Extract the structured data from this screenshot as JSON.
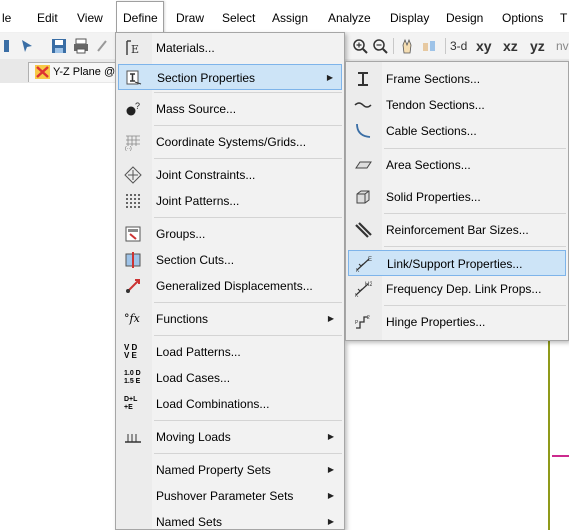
{
  "menubar": {
    "items": [
      {
        "label": "le"
      },
      {
        "label": "Edit"
      },
      {
        "label": "View"
      },
      {
        "label": "Define"
      },
      {
        "label": "Draw"
      },
      {
        "label": "Select"
      },
      {
        "label": "Assign"
      },
      {
        "label": "Analyze"
      },
      {
        "label": "Display"
      },
      {
        "label": "Design"
      },
      {
        "label": "Options"
      },
      {
        "label": "T"
      }
    ]
  },
  "toolbar": {
    "view_3d": "3-d",
    "view_xy": "xy",
    "view_xz": "xz",
    "view_yz": "yz",
    "view_nv": "nv"
  },
  "window_tab": {
    "title": "Y-Z Plane @"
  },
  "define_menu": {
    "items": [
      {
        "label": "Materials...",
        "icon": "materials-icon"
      },
      {
        "label": "Section Properties",
        "icon": "section-properties-icon",
        "submenu": true,
        "highlighted": true
      },
      {
        "label": "Mass Source...",
        "icon": "mass-source-icon"
      },
      {
        "label": "Coordinate Systems/Grids...",
        "icon": "grid-icon"
      },
      {
        "label": "Joint Constraints...",
        "icon": "joint-constraints-icon"
      },
      {
        "label": "Joint Patterns...",
        "icon": "joint-patterns-icon"
      },
      {
        "label": "Groups...",
        "icon": "groups-icon"
      },
      {
        "label": "Section Cuts...",
        "icon": "section-cuts-icon"
      },
      {
        "label": "Generalized Displacements...",
        "icon": "generalized-displacements-icon"
      },
      {
        "label": "Functions",
        "icon": "functions-icon",
        "submenu": true
      },
      {
        "label": "Load Patterns...",
        "icon": "load-patterns-icon"
      },
      {
        "label": "Load Cases...",
        "icon": "load-cases-icon"
      },
      {
        "label": "Load Combinations...",
        "icon": "load-combinations-icon"
      },
      {
        "label": "Moving Loads",
        "icon": "moving-loads-icon",
        "submenu": true
      },
      {
        "label": "Named Property Sets",
        "submenu": true
      },
      {
        "label": "Pushover Parameter Sets",
        "submenu": true
      },
      {
        "label": "Named Sets",
        "submenu": true
      }
    ],
    "icon_text": {
      "functions": "°fx",
      "load_patterns_top": "V D",
      "load_patterns_bottom": "V E",
      "load_cases_top": "1.0 D",
      "load_cases_bottom": "1.5 E",
      "load_combos_top": "D+L",
      "load_combos_bottom": "+E"
    }
  },
  "section_submenu": {
    "items": [
      {
        "label": "Frame Sections...",
        "icon": "frame-sections-icon"
      },
      {
        "label": "Tendon Sections...",
        "icon": "tendon-sections-icon"
      },
      {
        "label": "Cable Sections...",
        "icon": "cable-sections-icon"
      },
      {
        "label": "Area Sections...",
        "icon": "area-sections-icon"
      },
      {
        "label": "Solid Properties...",
        "icon": "solid-properties-icon"
      },
      {
        "label": "Reinforcement Bar Sizes...",
        "icon": "rebar-sizes-icon"
      },
      {
        "label": "Link/Support Properties...",
        "icon": "link-support-icon",
        "highlighted": true
      },
      {
        "label": "Frequency Dep. Link Props...",
        "icon": "frequency-link-icon"
      },
      {
        "label": "Hinge Properties...",
        "icon": "hinge-properties-icon"
      }
    ]
  },
  "colors": {
    "highlight_bg": "#cde4f7",
    "highlight_border": "#7eb4ea",
    "frame_line": "#8f9a1a",
    "frame_line_red": "#cc2a8e"
  }
}
